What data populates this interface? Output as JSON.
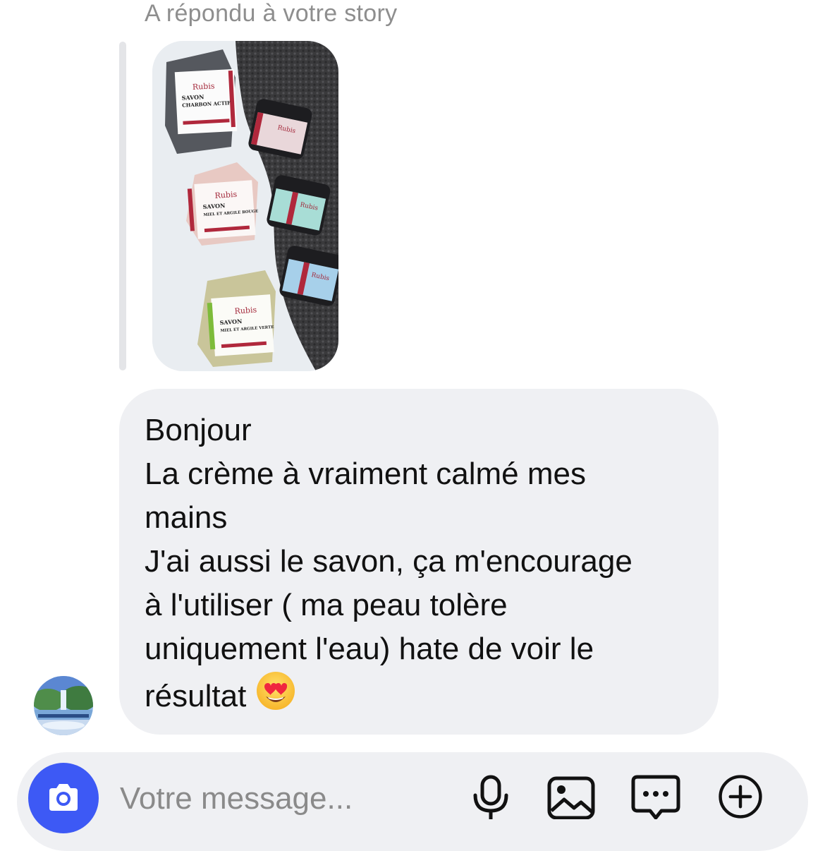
{
  "story_reply": {
    "header": "A répondu à votre story",
    "thumbnail": {
      "brand_label": "Rubis",
      "soaps": [
        {
          "name": "SAVON",
          "subtitle": "CHARBON ACTIF",
          "accent": "#b0283c"
        },
        {
          "name": "SAVON",
          "subtitle": "MIEL ET ARGILE ROUGE",
          "accent": "#b0283c"
        },
        {
          "name": "SAVON",
          "subtitle": "MIEL ET ARGILE VERTE",
          "accent": "#7dbb3a"
        }
      ],
      "jars": [
        {
          "label": "Rubis",
          "color": "#e9d7da"
        },
        {
          "label": "Rubis",
          "color": "#a8ddd6"
        },
        {
          "label": "Rubis",
          "color": "#a7d0ea"
        }
      ]
    }
  },
  "message": {
    "lines": [
      "Bonjour",
      "La crème à vraiment calmé mes",
      "mains",
      "J'ai aussi le savon, ça m'encourage",
      "à l'utiliser ( ma peau tolère",
      "uniquement l'eau) hate de voir le",
      "résultat"
    ],
    "emoji": "smiling-face-with-heart-eyes"
  },
  "sender": {
    "avatar_icon": "landscape-avatar"
  },
  "composer": {
    "placeholder": "Votre message...",
    "buttons": [
      {
        "icon": "camera-icon",
        "color": "#3d59f5"
      },
      {
        "icon": "microphone-icon"
      },
      {
        "icon": "gallery-icon"
      },
      {
        "icon": "sticker-chat-icon"
      },
      {
        "icon": "plus-circle-icon"
      }
    ]
  }
}
